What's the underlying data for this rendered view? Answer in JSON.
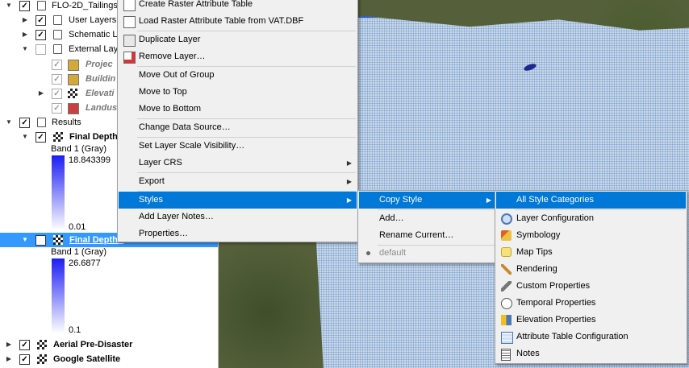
{
  "layers": {
    "flo2d_group": "FLO-2D_Tailings",
    "user_layers": "User Layers",
    "schematic_layers": "Schematic La",
    "external_layers": "External Lay",
    "project": "Projec",
    "buildings": "Buildin",
    "elevation": "Elevati",
    "landuse": "Landus",
    "results": "Results",
    "final_depth": "Final Depth",
    "band1_a": "Band 1 (Gray)",
    "max_a": "18.843399",
    "min_a": "0.01",
    "final_depth_sel": "Final Depth r",
    "band1_b": "Band 1 (Gray)",
    "max_b": "26.6877",
    "min_b": "0.1",
    "aerial": "Aerial Pre-Disaster",
    "google": "Google Satellite"
  },
  "colors": {
    "swatch_project": "#d4a93a",
    "swatch_buildings": "#d4a93a",
    "swatch_landuse": "#c94040",
    "selection": "#3399ff",
    "menu_highlight": "#0078d7",
    "flood_outline": "#1f4fd0"
  },
  "context_menu": {
    "items": [
      {
        "label": "Create Raster Attribute Table",
        "icon": "table-icon"
      },
      {
        "label": "Load Raster Attribute Table from VAT.DBF",
        "icon": "table-plus-icon"
      },
      {
        "label": "Duplicate Layer",
        "icon": "duplicate-icon"
      },
      {
        "label": "Remove Layer…",
        "icon": "remove-layer-icon"
      },
      {
        "label": "Move Out of Group"
      },
      {
        "label": "Move to Top"
      },
      {
        "label": "Move to Bottom"
      },
      {
        "label": "Change Data Source…"
      },
      {
        "label": "Set Layer Scale Visibility…"
      },
      {
        "label": "Layer CRS"
      },
      {
        "label": "Export"
      },
      {
        "label": "Styles"
      },
      {
        "label": "Add Layer Notes…"
      },
      {
        "label": "Properties…"
      }
    ]
  },
  "styles_menu": {
    "items": [
      {
        "label": "Copy Style"
      },
      {
        "label": "Add…"
      },
      {
        "label": "Rename Current…"
      },
      {
        "label": "default"
      }
    ]
  },
  "copy_style_menu": {
    "items": [
      {
        "label": "All Style Categories"
      },
      {
        "label": "Layer Configuration",
        "icon": "layer-config-icon"
      },
      {
        "label": "Symbology",
        "icon": "symbology-icon"
      },
      {
        "label": "Map Tips",
        "icon": "map-tips-icon"
      },
      {
        "label": "Rendering",
        "icon": "rendering-icon"
      },
      {
        "label": "Custom Properties",
        "icon": "custom-properties-icon"
      },
      {
        "label": "Temporal Properties",
        "icon": "clock-icon"
      },
      {
        "label": "Elevation Properties",
        "icon": "elevation-icon"
      },
      {
        "label": "Attribute Table Configuration",
        "icon": "attribute-table-icon"
      },
      {
        "label": "Notes",
        "icon": "notes-icon"
      }
    ]
  }
}
